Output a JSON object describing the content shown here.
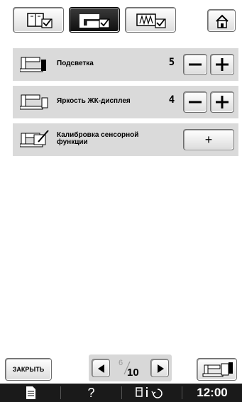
{
  "tabs": [
    {
      "icon": "settings-machine-icon"
    },
    {
      "icon": "settings-embroidery-icon",
      "selected": true
    },
    {
      "icon": "settings-stitch-icon"
    }
  ],
  "home_icon": "home-icon",
  "settings": [
    {
      "icon": "backlight-machine-icon",
      "label": "Подсветка",
      "value": "5"
    },
    {
      "icon": "lcd-brightness-machine-icon",
      "label": "Яркость ЖК-дисплея",
      "value": "4"
    },
    {
      "icon": "touch-calibration-icon",
      "label_line1": "Калибровка сенсорной",
      "label_line2": "функции",
      "button_label": "+"
    }
  ],
  "footer": {
    "close_label": "ЗАКРЫТЬ",
    "page_current": "6",
    "page_total": "10",
    "machine_icon": "machine-switch-icon"
  },
  "status_bar": {
    "help": "?",
    "time": "12:00"
  }
}
